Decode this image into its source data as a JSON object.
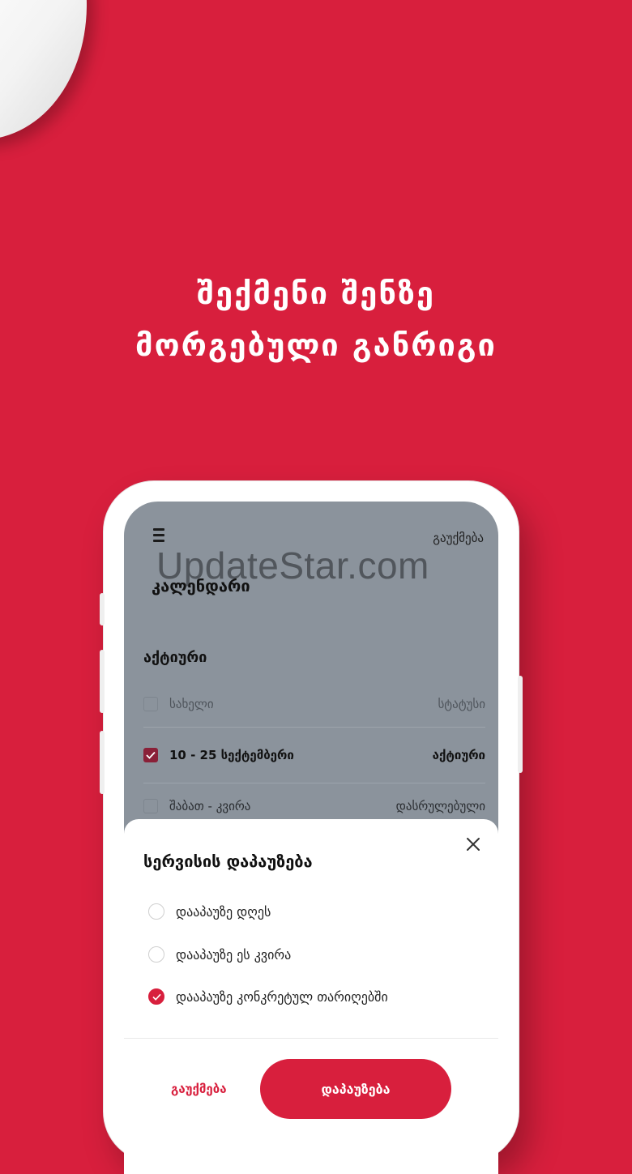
{
  "headline": {
    "line1": "შექმენი შენზე",
    "line2": "მორგებული განრიგი"
  },
  "app": {
    "cancel_top": "გაუქმება",
    "calendar_title": "კალენდარი",
    "watermark": "UpdateStar.com",
    "active_section": "აქტიური",
    "table": {
      "header": {
        "name": "სახელი",
        "status": "სტატუსი"
      },
      "rows": [
        {
          "name": "10 - 25 სექტემბერი",
          "status": "აქტიური",
          "checked": true
        },
        {
          "name": "შაბათ - კვირა",
          "status": "დასრულებული",
          "checked": false
        }
      ]
    }
  },
  "sheet": {
    "title": "სერვისის დაპაუზება",
    "options": [
      {
        "label": "დააპაუზე დღეს",
        "selected": false
      },
      {
        "label": "დააპაუზე ეს კვირა",
        "selected": false
      },
      {
        "label": "დააპაუზე კონკრეტულ თარიღებში",
        "selected": true
      }
    ],
    "cancel_label": "გაუქმება",
    "confirm_label": "დაპაუზება"
  },
  "icons": {
    "menu": "hamburger-icon",
    "close": "close-icon",
    "check": "checkmark-icon"
  },
  "colors": {
    "brand_red": "#d81f3d",
    "checkbox_checked": "#8a2038",
    "overlay_gray": "#8b939c"
  }
}
